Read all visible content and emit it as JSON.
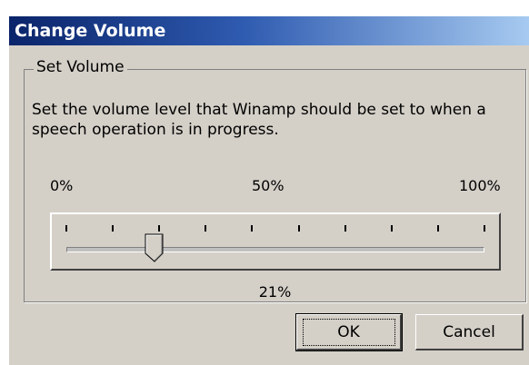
{
  "window": {
    "title": "Change Volume"
  },
  "group": {
    "label": "Set Volume",
    "description": "Set the volume level that Winamp should be set to when a speech operation is in progress."
  },
  "slider": {
    "min_label": "0%",
    "mid_label": "50%",
    "max_label": "100%",
    "value_percent": 21,
    "value_label": "21%",
    "tick_count": 10
  },
  "buttons": {
    "ok": "OK",
    "cancel": "Cancel"
  }
}
